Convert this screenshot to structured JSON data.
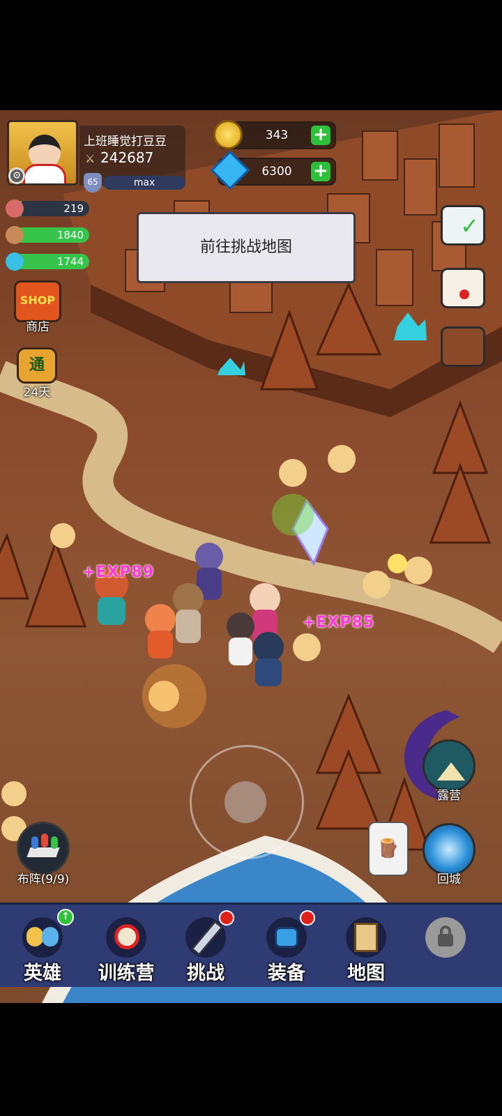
{
  "player": {
    "name": "上班睡觉打豆豆",
    "power": "242687",
    "level": "65",
    "level_status": "max"
  },
  "currency": {
    "gold": "343",
    "gems": "6300"
  },
  "resources": [
    {
      "icon": "meat-icon",
      "value": "219",
      "fill": 0.1
    },
    {
      "icon": "drumstick-icon",
      "value": "1840",
      "fill": 1.0
    },
    {
      "icon": "crystal-icon",
      "value": "1744",
      "fill": 1.0
    }
  ],
  "message": "前往挑战地图",
  "left_buttons": {
    "shop_badge": "SHOP",
    "shop": "商店",
    "pass_badge": "通",
    "pass": "24天"
  },
  "right_buttons": {
    "camp": "露营",
    "return_city": "回城",
    "formation": "布阵(9/9)"
  },
  "exp_popups": [
    "+EXP89",
    "+EXP85"
  ],
  "nav": [
    {
      "label": "英雄",
      "icon": "heroes-icon",
      "badge": "upgrade"
    },
    {
      "label": "训练营",
      "icon": "training-camp-icon",
      "badge": ""
    },
    {
      "label": "挑战",
      "icon": "sword-icon",
      "badge": "red-dot"
    },
    {
      "label": "装备",
      "icon": "equipment-icon",
      "badge": "red-dot"
    },
    {
      "label": "地图",
      "icon": "map-icon",
      "badge": ""
    },
    {
      "label": "",
      "icon": "locked-icon",
      "badge": ""
    }
  ]
}
